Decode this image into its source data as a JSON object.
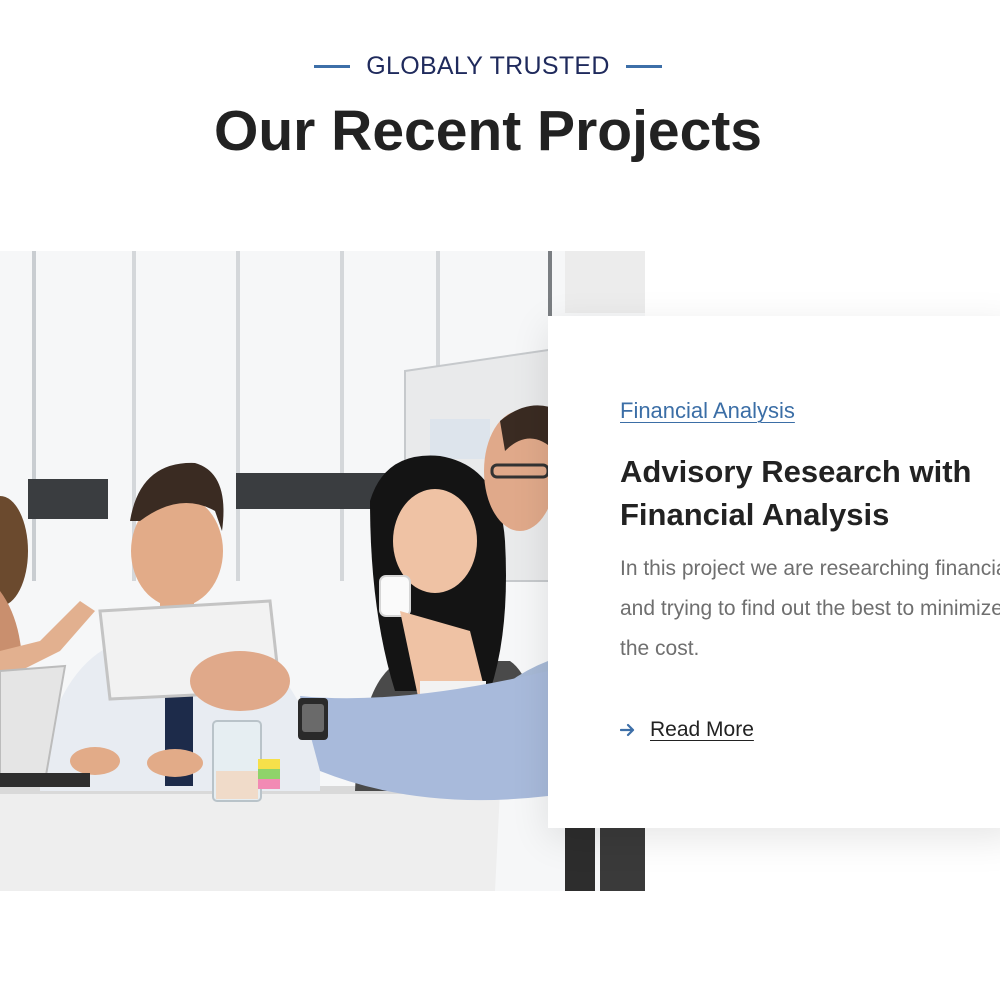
{
  "header": {
    "eyebrow": "GLOBALY TRUSTED",
    "title": "Our Recent Projects"
  },
  "project": {
    "image_alt": "Business team meeting around a table with a tablet",
    "category": "Financial Analysis",
    "title": "Advisory Research with Financial Analysis",
    "description": "In this project we are researching financial and trying to find out the best to minimize the cost.",
    "read_more": "Read More",
    "arrow_icon": "arrow-right-icon"
  },
  "colors": {
    "accent": "#3d6fa8",
    "eyebrow_text": "#1f2a5c",
    "title_text": "#222222",
    "body_text": "#6f6f6f"
  }
}
